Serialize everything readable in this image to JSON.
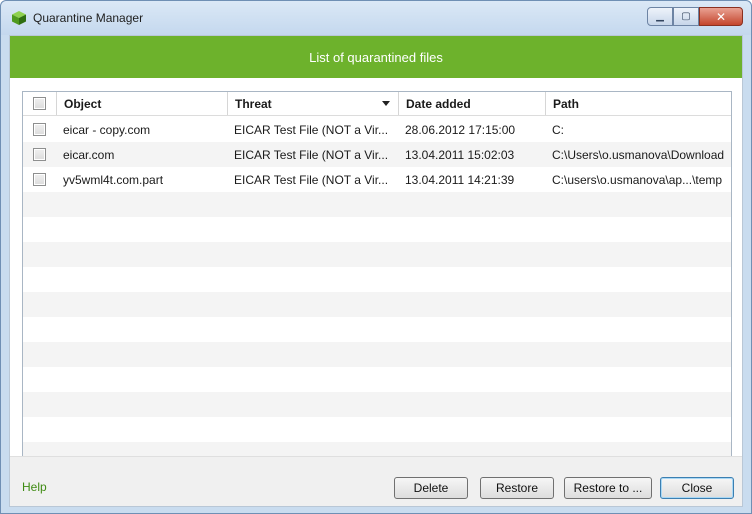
{
  "window": {
    "title": "Quarantine Manager"
  },
  "banner": {
    "text": "List of quarantined files"
  },
  "table": {
    "columns": [
      "Object",
      "Threat",
      "Date added",
      "Path"
    ],
    "rows": [
      {
        "object": "eicar - copy.com",
        "threat": "EICAR Test File (NOT a Vir...",
        "date_added": "28.06.2012 17:15:00",
        "path": "C:"
      },
      {
        "object": "eicar.com",
        "threat": "EICAR Test File (NOT a Vir...",
        "date_added": "13.04.2011 15:02:03",
        "path": "C:\\Users\\o.usmanova\\Download"
      },
      {
        "object": "yv5wml4t.com.part",
        "threat": "EICAR Test File (NOT a Vir...",
        "date_added": "13.04.2011 14:21:39",
        "path": "C:\\users\\o.usmanova\\ap...\\temp"
      }
    ]
  },
  "footer": {
    "help": "Help",
    "delete": "Delete",
    "restore": "Restore",
    "restore_to": "Restore to ...",
    "close": "Close"
  },
  "colors": {
    "banner": "#6db22c",
    "help_link": "#3f8b13"
  },
  "icons": {
    "app": "green-cube-icon",
    "sort": "sort-descending-icon"
  }
}
